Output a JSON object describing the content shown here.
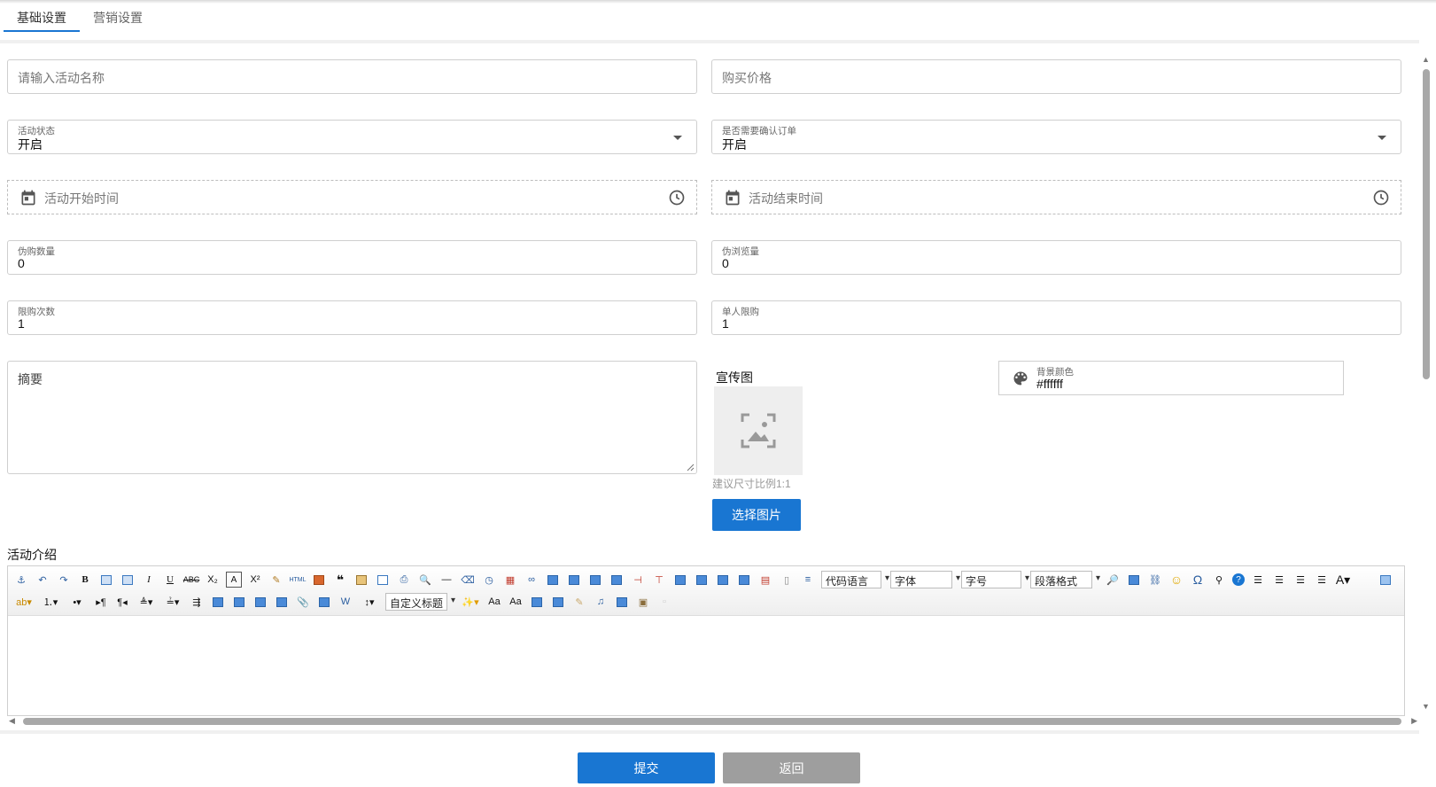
{
  "tabs": [
    {
      "label": "基础设置",
      "active": true
    },
    {
      "label": "营销设置",
      "active": false
    }
  ],
  "form": {
    "activity_name_placeholder": "请输入活动名称",
    "price_placeholder": "购买价格",
    "status": {
      "label": "活动状态",
      "value": "开启"
    },
    "confirm_order": {
      "label": "是否需要确认订单",
      "value": "开启"
    },
    "start_time_placeholder": "活动开始时间",
    "end_time_placeholder": "活动结束时间",
    "fake_purchase": {
      "label": "伪购数量",
      "value": "0"
    },
    "fake_views": {
      "label": "伪浏览量",
      "value": "0"
    },
    "purchase_limit": {
      "label": "限购次数",
      "value": "1"
    },
    "single_limit": {
      "label": "单人限购",
      "value": "1"
    },
    "summary_placeholder": "摘要",
    "promo_image": {
      "label": "宣传图",
      "hint": "建议尺寸比例1:1",
      "button": "选择图片"
    },
    "bg_color": {
      "label": "背景颜色",
      "value": "#ffffff"
    },
    "intro_label": "活动介绍"
  },
  "editor": {
    "selects_row1": [
      "代码语言",
      "字体",
      "字号",
      "段落格式"
    ],
    "selects_row2": [
      "自定义标题"
    ]
  },
  "actions": {
    "submit": "提交",
    "back": "返回"
  },
  "colors": {
    "accent": "#1976d2",
    "secondary": "#9e9e9e"
  }
}
